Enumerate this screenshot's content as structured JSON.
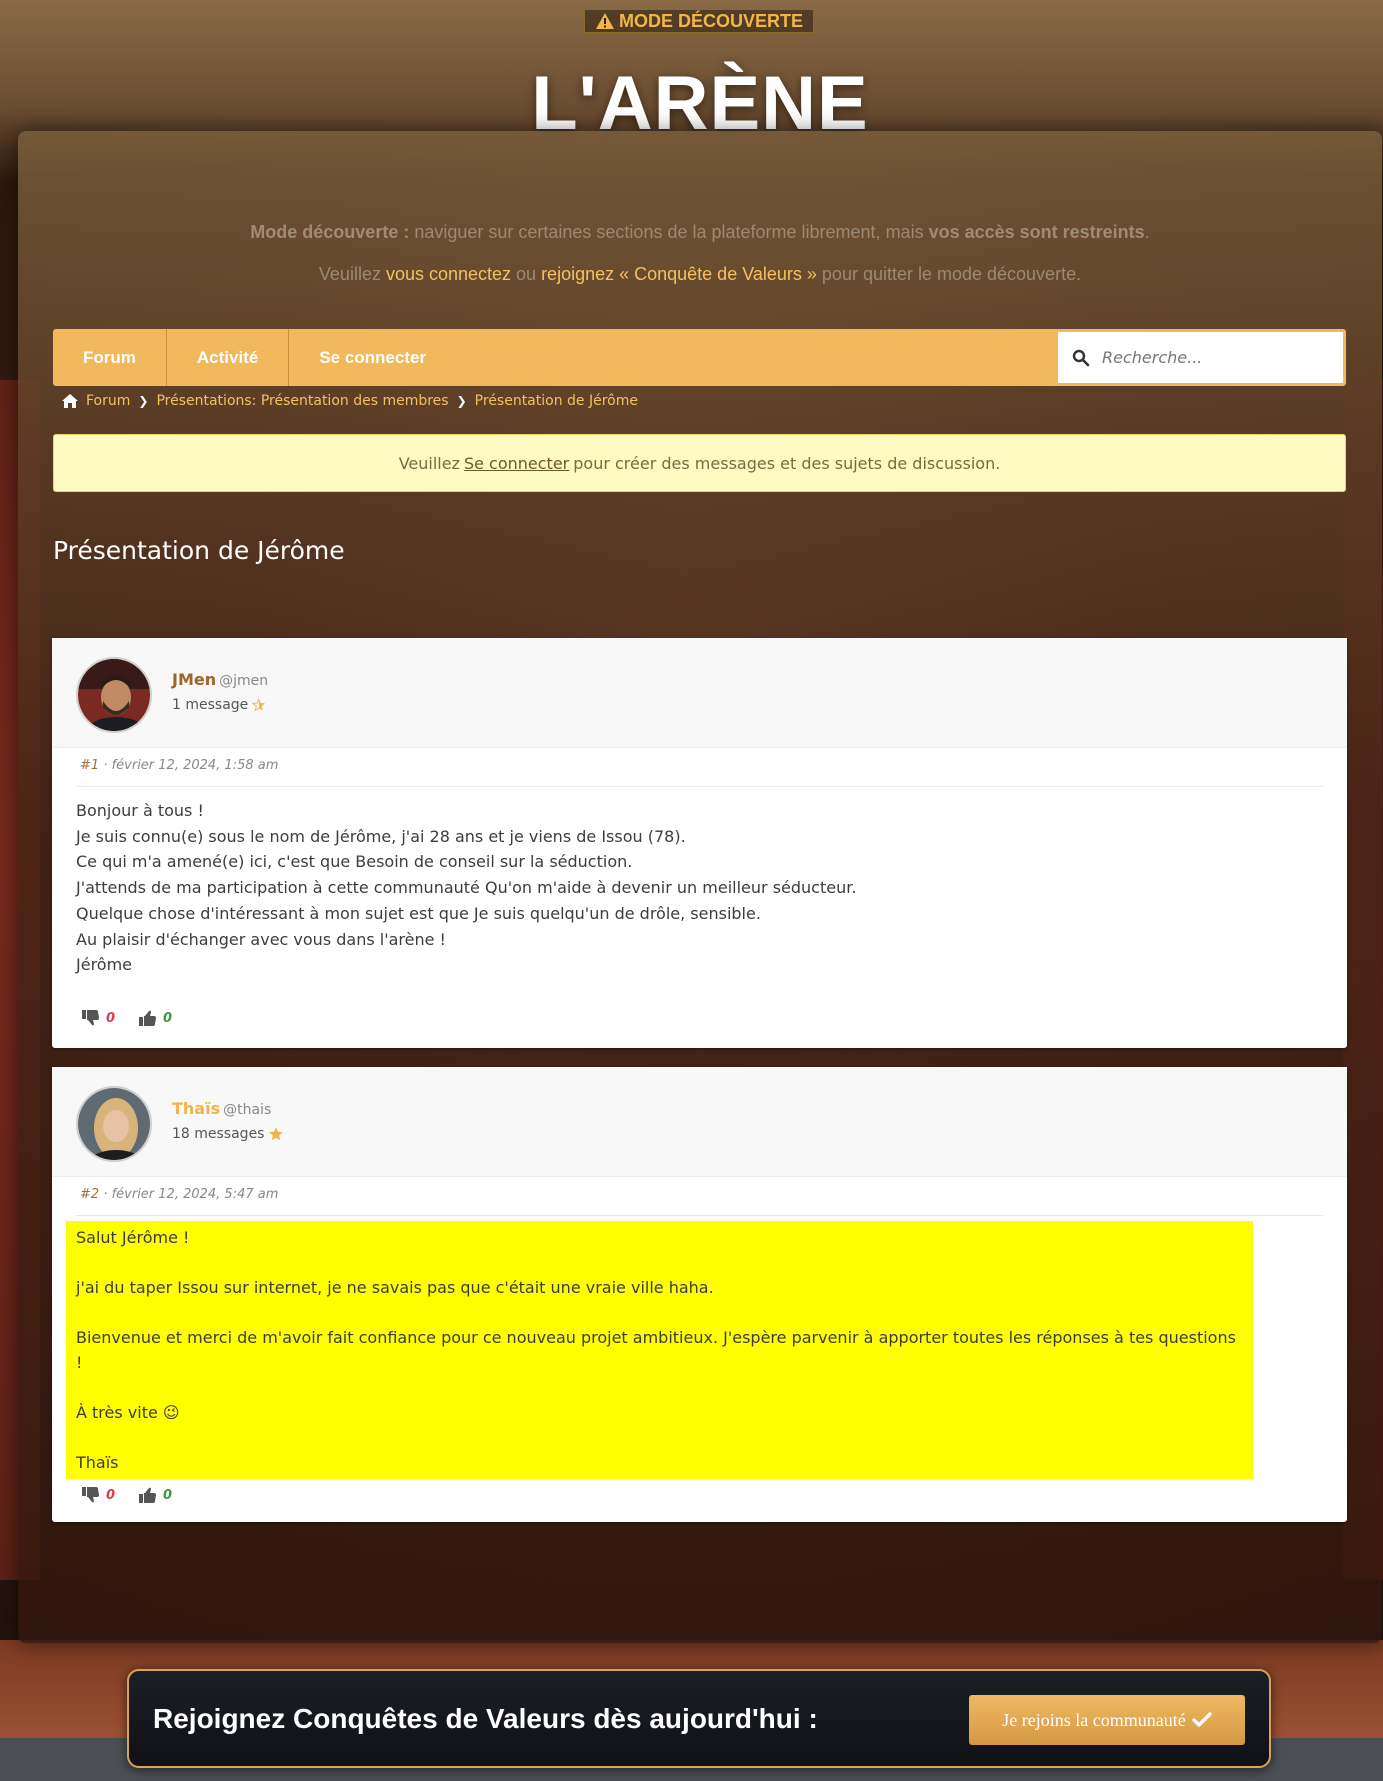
{
  "mode_badge": {
    "icon": "warning-icon",
    "label": "MODE DÉCOUVERTE"
  },
  "logo": "L'ARÈNE",
  "intro": {
    "line1_bold": "Mode découverte :",
    "line1_text": " naviguer sur certaines sections de la plateforme librement, mais ",
    "line1_bold2": "vos accès sont restreints",
    "line1_end": ".",
    "line2_a": "Veuillez ",
    "line2_login": "vous connectez",
    "line2_b": " ou ",
    "line2_join": "rejoignez « Conquête de Valeurs »",
    "line2_c": " pour quitter le mode découverte."
  },
  "nav": {
    "items": [
      {
        "label": "Forum"
      },
      {
        "label": "Activité"
      },
      {
        "label": "Se connecter"
      }
    ],
    "search_placeholder": "Recherche..."
  },
  "breadcrumb": {
    "items": [
      "Forum",
      "Présentations: Présentation des membres",
      "Présentation de Jérôme"
    ]
  },
  "notice": {
    "before": "Veuillez",
    "link": "Se connecter",
    "after": "pour créer des messages et des sujets de discussion."
  },
  "topic_title": "Présentation de Jérôme",
  "posts": [
    {
      "author": "JMen",
      "handle": "@jmen",
      "author_color": "#a0632a",
      "message_count": "1 message",
      "number": "#1",
      "date": "· février 12, 2024, 1:58 am",
      "lines": [
        "Bonjour à tous !",
        "Je suis connu(e) sous le nom de Jérôme, j'ai 28 ans et je viens de Issou (78).",
        "Ce qui m'a amené(e) ici, c'est que Besoin de conseil sur la séduction.",
        "J'attends de ma participation à cette communauté Qu'on m'aide à devenir un meilleur séducteur.",
        "Quelque chose d'intéressant à mon sujet est que Je suis quelqu'un de drôle, sensible.",
        "Au plaisir d'échanger avec vous dans l'arène !",
        "Jérôme"
      ],
      "dislikes": "0",
      "likes": "0"
    },
    {
      "author": "Thaïs",
      "handle": "@thais",
      "author_color": "#f0b54a",
      "message_count": "18 messages",
      "number": "#2",
      "date": "· février 12, 2024, 5:47 am",
      "lines": [
        "Salut Jérôme !",
        "",
        "j'ai du taper Issou sur internet, je ne savais pas que c'était une vraie ville haha.",
        "",
        "Bienvenue et merci de m'avoir fait confiance pour ce nouveau projet ambitieux. J'espère parvenir à apporter toutes les réponses à tes questions !",
        "",
        "À très vite 😉",
        "",
        "Thaïs"
      ],
      "dislikes": "0",
      "likes": "0"
    }
  ],
  "cta": {
    "text": "Rejoignez Conquêtes de Valeurs dès aujourd'hui :",
    "button": "Je rejoins la communauté"
  }
}
